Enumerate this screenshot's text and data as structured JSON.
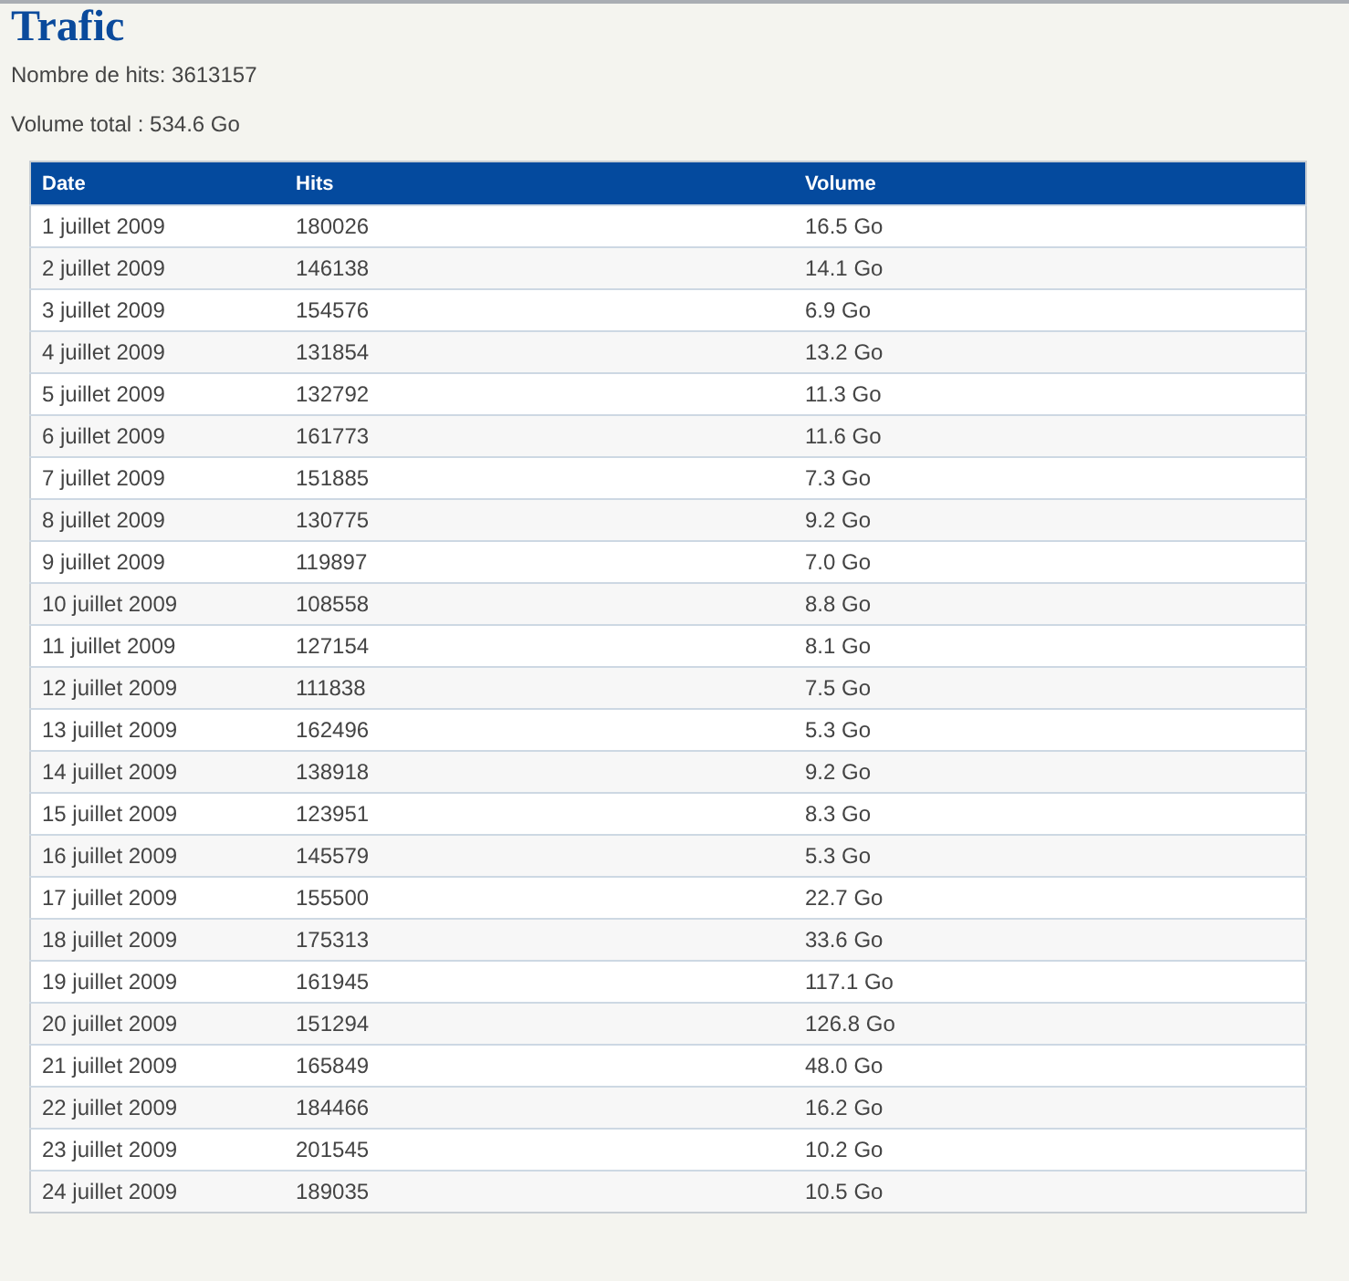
{
  "title": "Trafic",
  "stats": [
    "Nombre de hits: 3613157",
    "Volume total : 534.6 Go"
  ],
  "table": {
    "columns": [
      "Date",
      "Hits",
      "Volume"
    ],
    "rows": [
      [
        "1 juillet 2009",
        "180026",
        "16.5 Go"
      ],
      [
        "2 juillet 2009",
        "146138",
        "14.1 Go"
      ],
      [
        "3 juillet 2009",
        "154576",
        "6.9 Go"
      ],
      [
        "4 juillet 2009",
        "131854",
        "13.2 Go"
      ],
      [
        "5 juillet 2009",
        "132792",
        "11.3 Go"
      ],
      [
        "6 juillet 2009",
        "161773",
        "11.6 Go"
      ],
      [
        "7 juillet 2009",
        "151885",
        "7.3 Go"
      ],
      [
        "8 juillet 2009",
        "130775",
        "9.2 Go"
      ],
      [
        "9 juillet 2009",
        "119897",
        "7.0 Go"
      ],
      [
        "10 juillet 2009",
        "108558",
        "8.8 Go"
      ],
      [
        "11 juillet 2009",
        "127154",
        "8.1 Go"
      ],
      [
        "12 juillet 2009",
        "111838",
        "7.5 Go"
      ],
      [
        "13 juillet 2009",
        "162496",
        "5.3 Go"
      ],
      [
        "14 juillet 2009",
        "138918",
        "9.2 Go"
      ],
      [
        "15 juillet 2009",
        "123951",
        "8.3 Go"
      ],
      [
        "16 juillet 2009",
        "145579",
        "5.3 Go"
      ],
      [
        "17 juillet 2009",
        "155500",
        "22.7 Go"
      ],
      [
        "18 juillet 2009",
        "175313",
        "33.6 Go"
      ],
      [
        "19 juillet 2009",
        "161945",
        "117.1 Go"
      ],
      [
        "20 juillet 2009",
        "151294",
        "126.8 Go"
      ],
      [
        "21 juillet 2009",
        "165849",
        "48.0 Go"
      ],
      [
        "22 juillet 2009",
        "184466",
        "16.2 Go"
      ],
      [
        "23 juillet 2009",
        "201545",
        "10.2 Go"
      ],
      [
        "24 juillet 2009",
        "189035",
        "10.5 Go"
      ]
    ]
  }
}
